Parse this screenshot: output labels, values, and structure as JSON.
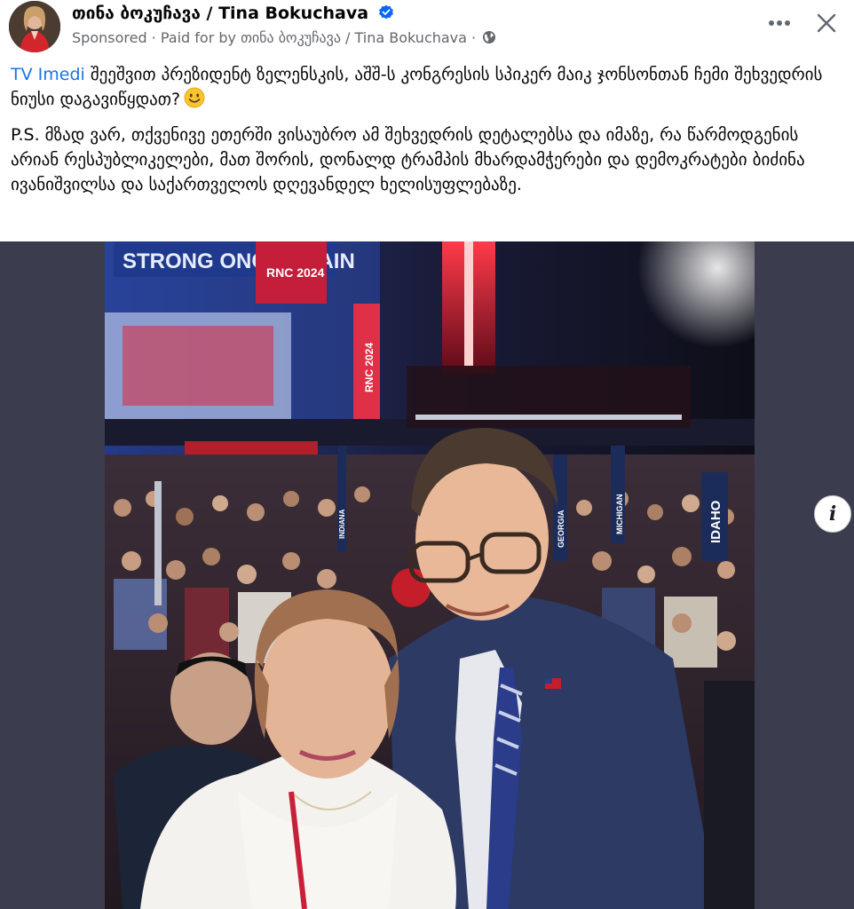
{
  "header": {
    "author_name": "თინა ბოკუჩავა / Tina Bokuchava",
    "sponsored_label": "Sponsored",
    "separator": " · ",
    "paid_for": "Paid for by თინა ბოკუჩავა / Tina Bokuchava",
    "separator2": " · ",
    "verified_icon": "verified-badge-icon",
    "audience_icon": "globe-icon",
    "more_icon": "more-options-icon",
    "close_icon": "close-icon"
  },
  "post": {
    "link_text": "TV Imedi",
    "paragraph1": " შეეშვით პრეზიდენტ ზელენსკის, აშშ-ს კონგრესის სპიკერ მაიკ ჯონსონთან ჩემი შეხვედრის ნიუსი დაგავიწყდათ?",
    "emoji": "slightly-smiling-face",
    "paragraph2": "P.S. მზად ვარ, თქვენივე ეთერში ვისაუბრო ამ შეხვედრის დეტალებსა და იმაზე, რა წარმოდგენის არიან რესპუბლიკელები, მათ შორის, დონალდ ტრამპის მხარდამჭერები და დემოკრატები ბიძინა ივანიშვილსა და საქართველოს დღევანდელ ხელისუფლებაზე."
  },
  "photo": {
    "banner_text": "STRONG ONCE AGAIN",
    "rnc_label": "RNC 2024",
    "rnc_vertical": "RNC 2024",
    "sign_idaho": "IDAHO",
    "sign_michigan": "MICHIGAN",
    "sign_georgia": "GEORGIA",
    "sign_other": "INDIANA"
  },
  "media": {
    "info_label": "i"
  },
  "colors": {
    "accent_link": "#1b74e4",
    "meta_text": "#65676b",
    "verified": "#0866ff",
    "media_bg": "#3b3d4f"
  }
}
